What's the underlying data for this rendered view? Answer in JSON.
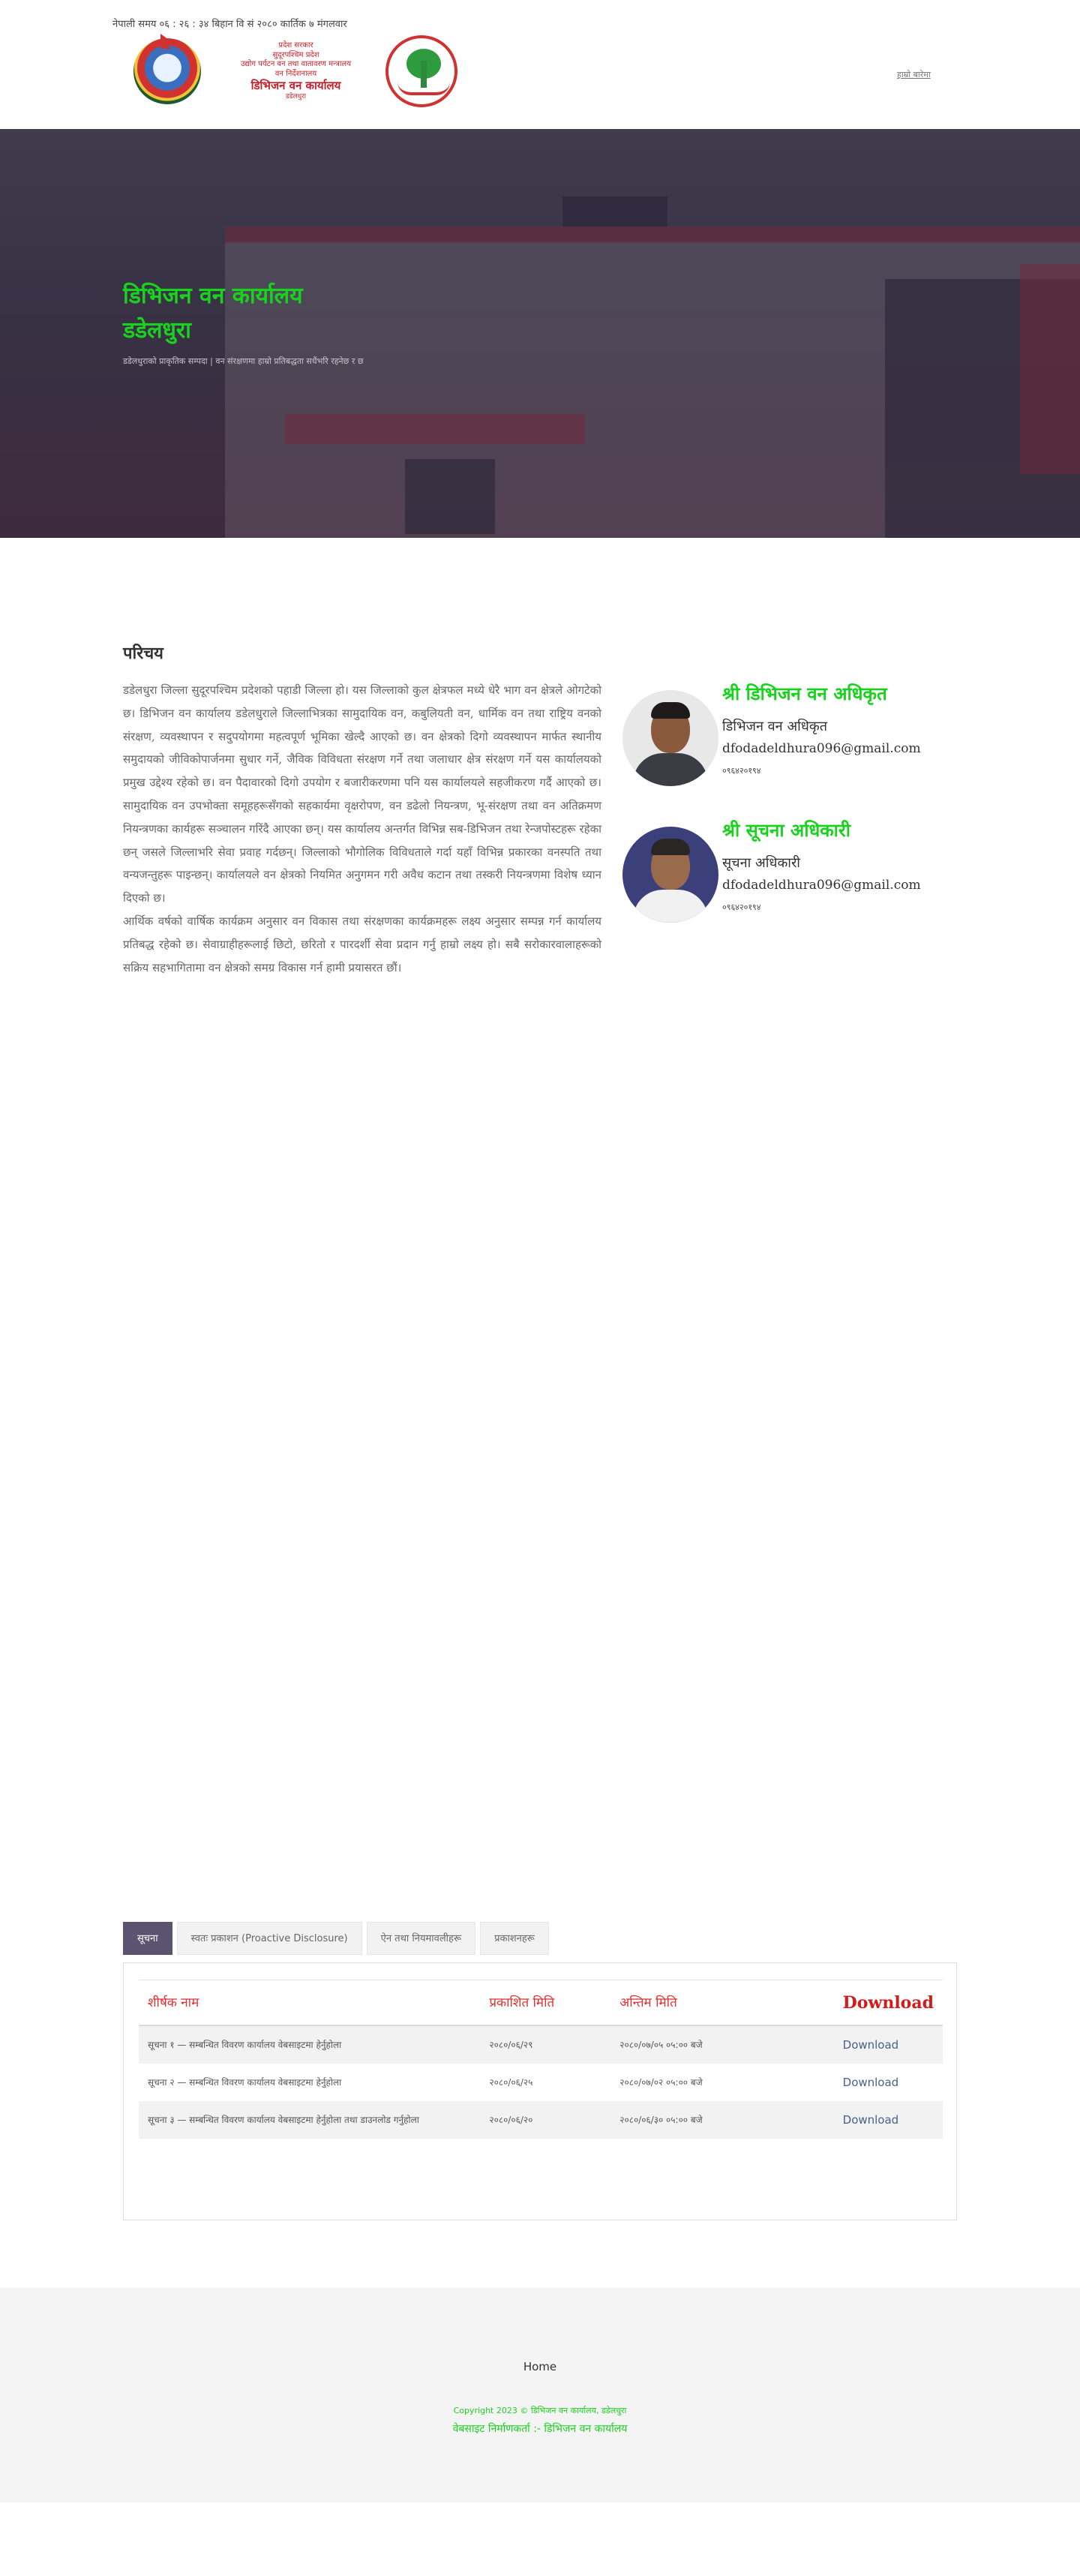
{
  "header": {
    "datetime": "नेपाली समय ०६ : २६ : ३४ बिहान   वि सं २०८० कार्तिक ७ मंगलवार",
    "office_lines": [
      "प्रदेश सरकार",
      "सुदूरपश्चिम प्रदेश",
      "उद्योग पर्यटन वन तथा वातावरण मन्त्रालय",
      "वन निर्देशनालय"
    ],
    "office_name": "डिभिजन वन कार्यालय",
    "office_place": "डडेलधुरा",
    "top_link": "हाम्रो बारेमा"
  },
  "hero": {
    "title": "डिभिजन वन कार्यालय डडेलधुरा",
    "subtitle": "डडेलधुराको प्राकृतिक सम्पदा | वन संरक्षणमा हाम्रो प्रतिबद्धता सधैंभरि रहनेछ र छ"
  },
  "about": {
    "title": "परिचय",
    "paragraphs": [
      "डडेलधुरा जिल्ला सुदूरपश्चिम प्रदेशको पहाडी जिल्ला हो। यस जिल्लाको कुल क्षेत्रफल मध्ये धेरै भाग वन क्षेत्रले ओगटेको छ। डिभिजन वन कार्यालय डडेलधुराले जिल्लाभित्रका सामुदायिक वन, कबुलियती वन, धार्मिक वन तथा राष्ट्रिय वनको संरक्षण, व्यवस्थापन र सदुपयोगमा महत्वपूर्ण भूमिका खेल्दै आएको छ। वन क्षेत्रको दिगो व्यवस्थापन मार्फत स्थानीय समुदायको जीविकोपार्जनमा सुधार गर्ने, जैविक विविधता संरक्षण गर्ने तथा जलाधार क्षेत्र संरक्षण गर्ने यस कार्यालयको प्रमुख उद्देश्य रहेको छ। वन पैदावारको दिगो उपयोग र बजारीकरणमा पनि यस कार्यालयले सहजीकरण गर्दै आएको छ। सामुदायिक वन उपभोक्ता समूहहरूसँगको सहकार्यमा वृक्षरोपण, वन डढेलो नियन्त्रण, भू-संरक्षण तथा वन अतिक्रमण नियन्त्रणका कार्यहरू सञ्चालन गरिंदै आएका छन्। यस कार्यालय अन्तर्गत विभिन्न सब-डिभिजन तथा रेन्जपोस्टहरू रहेका छन् जसले जिल्लाभरि सेवा प्रवाह गर्दछन्। जिल्लाको भौगोलिक विविधताले गर्दा यहाँ विभिन्न प्रकारका वनस्पति तथा वन्यजन्तुहरू पाइन्छन्। कार्यालयले वन क्षेत्रको नियमित अनुगमन गरी अवैध कटान तथा तस्करी नियन्त्रणमा विशेष ध्यान दिएको छ।",
      "आर्थिक वर्षको वार्षिक कार्यक्रम अनुसार वन विकास तथा संरक्षणका कार्यक्रमहरू लक्ष्य अनुसार सम्पन्न गर्न कार्यालय प्रतिबद्ध रहेको छ। सेवाग्राहीहरूलाई छिटो, छरितो र पारदर्शी सेवा प्रदान गर्नु हाम्रो लक्ष्य हो। सबै सरोकारवालाहरूको सक्रिय सहभागितामा वन क्षेत्रको समग्र विकास गर्न हामी प्रयासरत छौं।"
    ]
  },
  "staff": [
    {
      "name": "श्री डिभिजन वन अधिकृत",
      "role": "डिभिजन वन अधिकृत",
      "email": "dfodadeldhura096@gmail.com",
      "phone": "०९६४२०१९४"
    },
    {
      "name": "श्री सूचना अधिकारी",
      "role": "सूचना अधिकारी",
      "email": "dfodadeldhura096@gmail.com",
      "phone": "०९६४२०१९४"
    }
  ],
  "tabs": [
    "सूचना",
    "स्वतः प्रकाशन (Proactive Disclosure)",
    "ऐन तथा नियमावलीहरू",
    "प्रकाशनहरू"
  ],
  "table": {
    "headers": [
      "शीर्षक नाम",
      "प्रकाशित मिति",
      "अन्तिम मिति",
      "Download"
    ],
    "rows": [
      {
        "title": "सूचना १ — सम्बन्धित विवरण कार्यालय वेबसाइटमा हेर्नुहोला",
        "published": "२०८०/०६/२९",
        "deadline": "२०८०/०७/०५ ०५:०० बजे",
        "download": "Download"
      },
      {
        "title": "सूचना २ — सम्बन्धित विवरण कार्यालय वेबसाइटमा हेर्नुहोला",
        "published": "२०८०/०६/२५",
        "deadline": "२०८०/०७/०२ ०५:०० बजे",
        "download": "Download"
      },
      {
        "title": "सूचना ३ — सम्बन्धित विवरण कार्यालय वेबसाइटमा हेर्नुहोला तथा डाउनलोड गर्नुहोला",
        "published": "२०८०/०६/२०",
        "deadline": "२०८०/०६/३० ०५:०० बजे",
        "download": "Download"
      }
    ]
  },
  "footer": {
    "home": "Home",
    "copyright": "Copyright 2023 © डिभिजन वन कार्यालय, डडेलधुरा",
    "made_by": "वेबसाइट निर्माणकर्ता :- डिभिजन वन कार्यालय"
  },
  "colors": {
    "accent_green": "#19d21e",
    "tab_active": "#5a5470",
    "header_red": "#e03030"
  }
}
